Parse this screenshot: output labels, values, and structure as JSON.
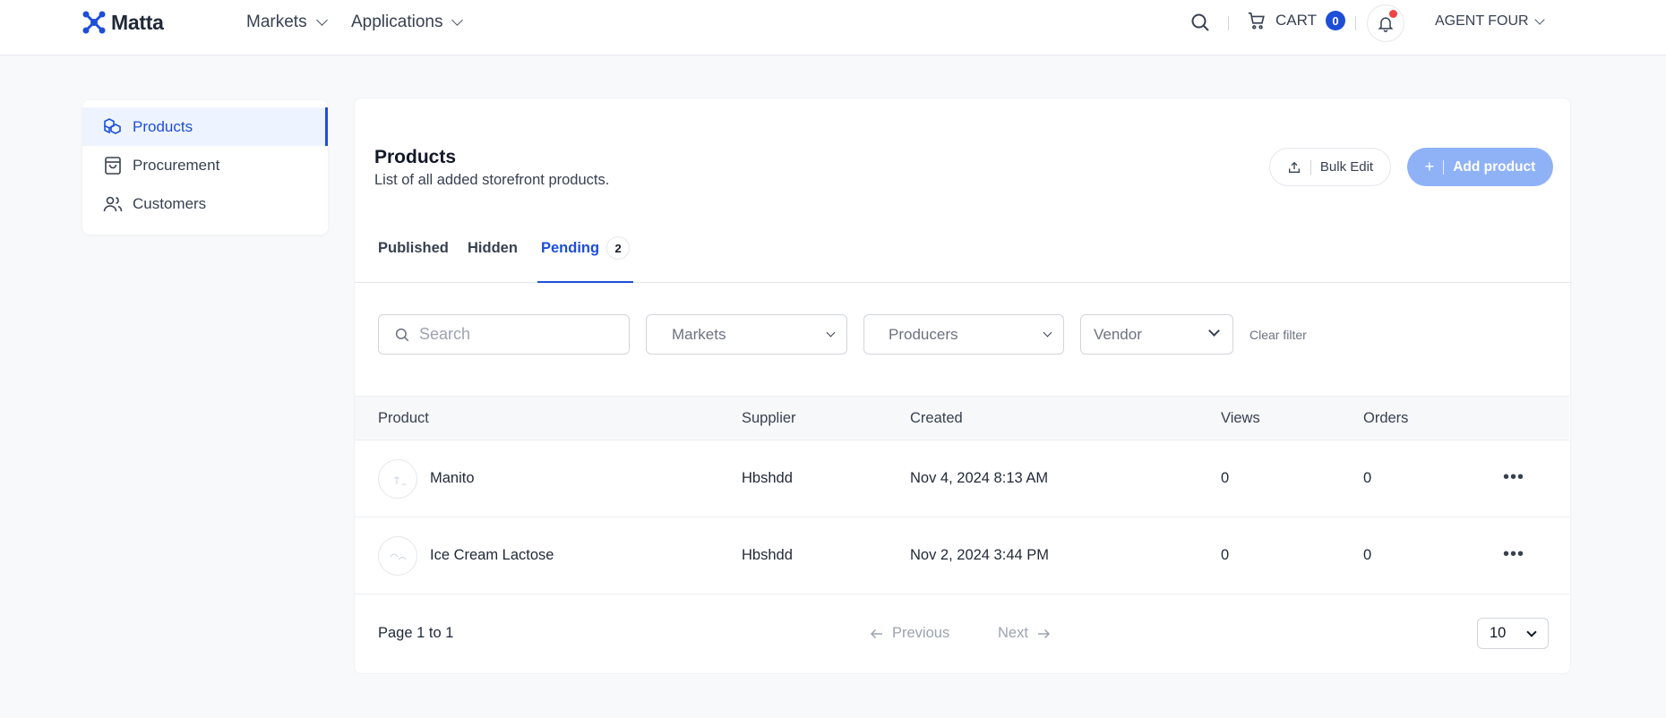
{
  "header": {
    "logo_text": "Matta",
    "nav": [
      {
        "label": "Markets"
      },
      {
        "label": "Applications"
      }
    ],
    "cart_label": "CART",
    "cart_count": "0",
    "user_name": "AGENT FOUR",
    "accent": "#1d4ed8"
  },
  "sidebar": {
    "items": [
      {
        "label": "Products",
        "icon": "boxes-icon",
        "active": true
      },
      {
        "label": "Procurement",
        "icon": "shopping-bag-icon",
        "active": false
      },
      {
        "label": "Customers",
        "icon": "users-icon",
        "active": false
      }
    ]
  },
  "main": {
    "title": "Products",
    "subtitle": "List of all added storefront products.",
    "bulk_edit_label": "Bulk Edit",
    "add_product_label": "Add product",
    "tabs": [
      {
        "label": "Published"
      },
      {
        "label": "Hidden"
      },
      {
        "label": "Pending",
        "count": "2",
        "active": true
      }
    ],
    "filters": {
      "search_placeholder": "Search",
      "markets": "Markets",
      "producers": "Producers",
      "vendor": "Vendor",
      "clear": "Clear filter"
    },
    "table": {
      "columns": [
        "Product",
        "Supplier",
        "Created",
        "Views",
        "Orders"
      ],
      "rows": [
        {
          "product": "Manito",
          "supplier": "Hbshdd",
          "created": "Nov 4, 2024 8:13 AM",
          "views": "0",
          "orders": "0"
        },
        {
          "product": "Ice Cream Lactose",
          "supplier": "Hbshdd",
          "created": "Nov 2, 2024 3:44 PM",
          "views": "0",
          "orders": "0"
        }
      ]
    },
    "pagination": {
      "page_text": "Page 1 to 1",
      "previous": "Previous",
      "next": "Next",
      "per_page": "10"
    }
  }
}
